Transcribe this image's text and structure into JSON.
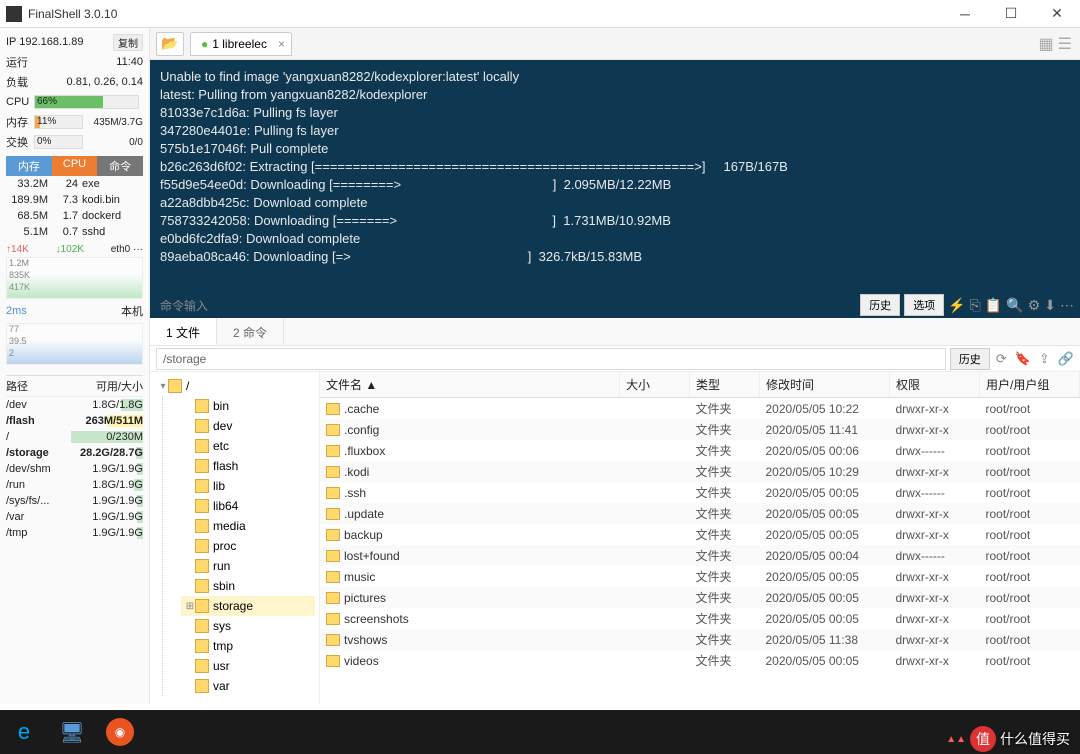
{
  "titlebar": {
    "title": "FinalShell 3.0.10"
  },
  "sidebar": {
    "ip": "IP 192.168.1.89",
    "copy": "复制",
    "uptime_lbl": "运行",
    "uptime": "11:40",
    "load_lbl": "负载",
    "load": "0.81, 0.26, 0.14",
    "cpu_lbl": "CPU",
    "cpu_pct": "66%",
    "mem_lbl": "内存",
    "mem_pct": "11%",
    "mem_val": "435M/3.7G",
    "swap_lbl": "交换",
    "swap_pct": "0%",
    "swap_val": "0/0",
    "proc_hdr": {
      "mem": "内存",
      "cpu": "CPU",
      "cmd": "命令"
    },
    "procs": [
      {
        "mem": "33.2M",
        "cpu": "24",
        "cmd": "exe"
      },
      {
        "mem": "189.9M",
        "cpu": "7.3",
        "cmd": "kodi.bin"
      },
      {
        "mem": "68.5M",
        "cpu": "1.7",
        "cmd": "dockerd"
      },
      {
        "mem": "5.1M",
        "cpu": "0.7",
        "cmd": "sshd"
      }
    ],
    "net": {
      "up": "↑14K",
      "down": "↓102K",
      "iface": "eth0 ···"
    },
    "graph1": {
      "l1": "1.2M",
      "l2": "835K",
      "l3": "417K"
    },
    "ping": "2ms",
    "host": "本机",
    "graph2": {
      "l1": "77",
      "l2": "39.5",
      "l3": "2"
    },
    "paths_hdr": {
      "path": "路径",
      "size": "可用/大小"
    },
    "paths": [
      {
        "p": "/dev",
        "s": "1.8G/1.8G",
        "w": "30%",
        "c": ""
      },
      {
        "p": "/flash",
        "s": "263M/511M",
        "w": "50%",
        "c": "yellow",
        "bold": true
      },
      {
        "p": "/",
        "s": "0/230M",
        "w": "100%",
        "c": ""
      },
      {
        "p": "/storage",
        "s": "28.2G/28.7G",
        "w": "10%",
        "c": "",
        "bold": true
      },
      {
        "p": "/dev/shm",
        "s": "1.9G/1.9G",
        "w": "8%",
        "c": ""
      },
      {
        "p": "/run",
        "s": "1.8G/1.9G",
        "w": "12%",
        "c": ""
      },
      {
        "p": "/sys/fs/...",
        "s": "1.9G/1.9G",
        "w": "8%",
        "c": ""
      },
      {
        "p": "/var",
        "s": "1.9G/1.9G",
        "w": "8%",
        "c": ""
      },
      {
        "p": "/tmp",
        "s": "1.9G/1.9G",
        "w": "8%",
        "c": ""
      }
    ]
  },
  "conn": {
    "tab_label": "1 libreelec",
    "history": "历史",
    "options": "选项"
  },
  "terminal_lines": [
    "Unable to find image 'yangxuan8282/kodexplorer:latest' locally",
    "latest: Pulling from yangxuan8282/kodexplorer",
    "81033e7c1d6a: Pulling fs layer",
    "347280e4401e: Pulling fs layer",
    "575b1e17046f: Pull complete",
    "b26c263d6f02: Extracting [==================================================>]     167B/167B",
    "f55d9e54ee0d: Downloading [========>                                          ]  2.095MB/12.22MB",
    "a22a8dbb425c: Download complete",
    "758733242058: Downloading [=======>                                           ]  1.731MB/10.92MB",
    "e0bd6fc2dfa9: Download complete",
    "89aeba08ca46: Downloading [=>                                                 ]  326.7kB/15.83MB"
  ],
  "cmd_input": "命令输入",
  "file_tabs": {
    "t1": "1 文件",
    "t2": "2 命令"
  },
  "path_input": "/storage",
  "path_history": "历史",
  "tree_root": "/",
  "tree": [
    "bin",
    "dev",
    "etc",
    "flash",
    "lib",
    "lib64",
    "media",
    "proc",
    "run",
    "sbin",
    "storage",
    "sys",
    "tmp",
    "usr",
    "var"
  ],
  "grid_hdr": {
    "name": "文件名 ▲",
    "size": "大小",
    "type": "类型",
    "mtime": "修改时间",
    "perm": "权限",
    "owner": "用户/用户组"
  },
  "files": [
    {
      "n": ".cache",
      "t": "文件夹",
      "m": "2020/05/05 10:22",
      "p": "drwxr-xr-x",
      "o": "root/root"
    },
    {
      "n": ".config",
      "t": "文件夹",
      "m": "2020/05/05 11:41",
      "p": "drwxr-xr-x",
      "o": "root/root"
    },
    {
      "n": ".fluxbox",
      "t": "文件夹",
      "m": "2020/05/05 00:06",
      "p": "drwx------",
      "o": "root/root"
    },
    {
      "n": ".kodi",
      "t": "文件夹",
      "m": "2020/05/05 10:29",
      "p": "drwxr-xr-x",
      "o": "root/root"
    },
    {
      "n": ".ssh",
      "t": "文件夹",
      "m": "2020/05/05 00:05",
      "p": "drwx------",
      "o": "root/root"
    },
    {
      "n": ".update",
      "t": "文件夹",
      "m": "2020/05/05 00:05",
      "p": "drwxr-xr-x",
      "o": "root/root"
    },
    {
      "n": "backup",
      "t": "文件夹",
      "m": "2020/05/05 00:05",
      "p": "drwxr-xr-x",
      "o": "root/root"
    },
    {
      "n": "lost+found",
      "t": "文件夹",
      "m": "2020/05/05 00:04",
      "p": "drwx------",
      "o": "root/root"
    },
    {
      "n": "music",
      "t": "文件夹",
      "m": "2020/05/05 00:05",
      "p": "drwxr-xr-x",
      "o": "root/root"
    },
    {
      "n": "pictures",
      "t": "文件夹",
      "m": "2020/05/05 00:05",
      "p": "drwxr-xr-x",
      "o": "root/root"
    },
    {
      "n": "screenshots",
      "t": "文件夹",
      "m": "2020/05/05 00:05",
      "p": "drwxr-xr-x",
      "o": "root/root"
    },
    {
      "n": "tvshows",
      "t": "文件夹",
      "m": "2020/05/05 11:38",
      "p": "drwxr-xr-x",
      "o": "root/root"
    },
    {
      "n": "videos",
      "t": "文件夹",
      "m": "2020/05/05 00:05",
      "p": "drwxr-xr-x",
      "o": "root/root"
    }
  ],
  "watermark": "什么值得买"
}
